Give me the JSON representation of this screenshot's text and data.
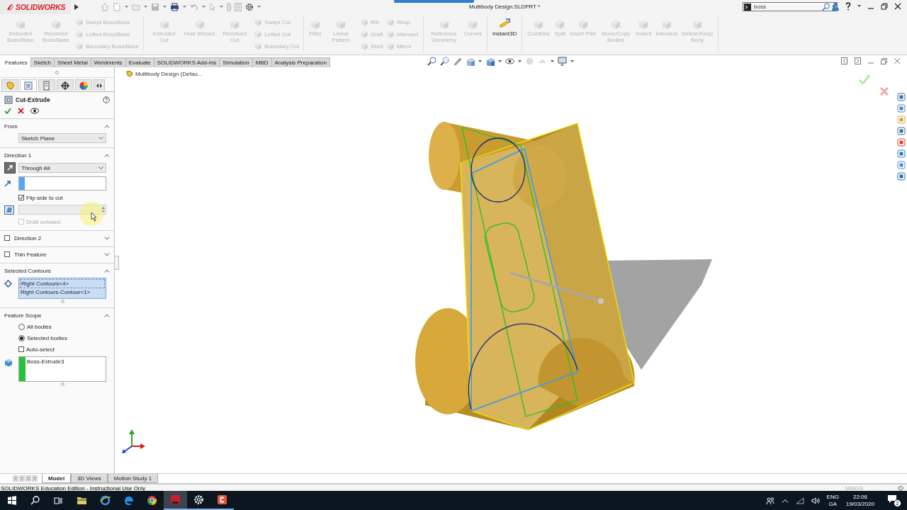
{
  "titlebar": {
    "logo": "SOLIDWORKS",
    "title": "Multibody Design.SLDPRT *",
    "search": {
      "value": "boss"
    }
  },
  "ribbon": {
    "groups": [
      {
        "items": [
          {
            "kind": "large",
            "label": "Extruded Boss/Base",
            "disabled": true
          },
          {
            "kind": "large",
            "label": "Revolved Boss/Base",
            "disabled": true
          },
          {
            "kind": "small",
            "label": "Swept Boss/Base",
            "disabled": true
          },
          {
            "kind": "small",
            "label": "Lofted Boss/Base",
            "disabled": true
          },
          {
            "kind": "small",
            "label": "Boundary Boss/Base",
            "disabled": true
          }
        ]
      },
      {
        "items": [
          {
            "kind": "large",
            "label": "Extruded Cut",
            "disabled": true
          },
          {
            "kind": "large",
            "label": "Hole Wizard",
            "disabled": true
          },
          {
            "kind": "large",
            "label": "Revolved Cut",
            "disabled": true
          },
          {
            "kind": "small",
            "label": "Swept Cut",
            "disabled": true
          },
          {
            "kind": "small",
            "label": "Lofted Cut",
            "disabled": true
          },
          {
            "kind": "small",
            "label": "Boundary Cut",
            "disabled": true
          }
        ]
      },
      {
        "items": [
          {
            "kind": "large",
            "label": "Fillet",
            "disabled": true
          },
          {
            "kind": "large",
            "label": "Linear Pattern",
            "disabled": true
          },
          {
            "kind": "small",
            "label": "Rib",
            "disabled": true
          },
          {
            "kind": "small",
            "label": "Draft",
            "disabled": true
          },
          {
            "kind": "small",
            "label": "Shell",
            "disabled": true
          },
          {
            "kind": "small",
            "label": "Wrap",
            "disabled": true
          },
          {
            "kind": "small",
            "label": "Intersect",
            "disabled": true
          },
          {
            "kind": "small",
            "label": "Mirror",
            "disabled": true
          }
        ]
      },
      {
        "items": [
          {
            "kind": "large",
            "label": "Reference Geometry",
            "disabled": true
          },
          {
            "kind": "large",
            "label": "Curves",
            "disabled": true
          }
        ]
      },
      {
        "items": [
          {
            "kind": "large",
            "label": "Instant3D",
            "disabled": false
          }
        ]
      },
      {
        "items": [
          {
            "kind": "large",
            "label": "Combine",
            "disabled": true
          },
          {
            "kind": "large",
            "label": "Split",
            "disabled": true
          },
          {
            "kind": "large",
            "label": "Insert Part",
            "disabled": true
          },
          {
            "kind": "large",
            "label": "Move/Copy Bodies",
            "disabled": true
          },
          {
            "kind": "large",
            "label": "Indent",
            "disabled": true
          },
          {
            "kind": "large",
            "label": "Intersect",
            "disabled": true
          },
          {
            "kind": "large",
            "label": "Delete/Keep Body",
            "disabled": true
          }
        ]
      }
    ]
  },
  "command_tabs": [
    {
      "label": "Features",
      "selected": true
    },
    {
      "label": "Sketch",
      "selected": false
    },
    {
      "label": "Sheet Metal",
      "selected": false
    },
    {
      "label": "Weldments",
      "selected": false
    },
    {
      "label": "Evaluate",
      "selected": false
    },
    {
      "label": "SOLIDWORKS Add-Ins",
      "selected": false
    },
    {
      "label": "Simulation",
      "selected": false
    },
    {
      "label": "MBD",
      "selected": false
    },
    {
      "label": "Analysis Preparation",
      "selected": false
    }
  ],
  "property_manager": {
    "panel_tabs": [
      {
        "selected": false
      },
      {
        "selected": true
      },
      {
        "selected": false
      },
      {
        "selected": false
      },
      {
        "selected": false
      }
    ],
    "title": "Cut-Extrude",
    "sections": [
      {
        "title": "From",
        "expanded": true,
        "controls": [
          {
            "kind": "dropdown",
            "value": "Sketch Plane"
          }
        ]
      },
      {
        "title": "Direction 1",
        "expanded": true,
        "controls": [
          {
            "kind": "end_condition",
            "value": "Through All"
          },
          {
            "kind": "depth"
          },
          {
            "kind": "checkbox",
            "label": "Flip side to cut",
            "checked": true,
            "disabled": false
          },
          {
            "kind": "spinner"
          },
          {
            "kind": "checkbox",
            "label": "Draft outward",
            "checked": false,
            "disabled": true
          }
        ]
      },
      {
        "title": "Direction 2",
        "expanded": false,
        "checked": false
      },
      {
        "title": "Thin Feature",
        "expanded": false,
        "checked": false
      },
      {
        "title": "Selected Contours",
        "expanded": true,
        "controls": [
          {
            "kind": "contour_list",
            "active": true,
            "items": [
              "Right Contours<4>",
              "Right Contours-Contour<1>"
            ]
          }
        ]
      },
      {
        "title": "Feature Scope",
        "expanded": true,
        "controls": [
          {
            "kind": "radio",
            "label": "All bodies",
            "selected": false
          },
          {
            "kind": "radio",
            "label": "Selected bodies",
            "selected": true
          },
          {
            "kind": "checkbox",
            "label": "Auto-select",
            "checked": false,
            "disabled": false
          },
          {
            "kind": "body_list",
            "active": false,
            "items": [
              "Boss-Extrude3"
            ]
          }
        ]
      }
    ]
  },
  "viewport": {
    "breadcrumb": "Multibody Design  (Defau..."
  },
  "bottom_tabs": [
    {
      "label": "Model",
      "selected": true
    },
    {
      "label": "3D Views",
      "selected": false
    },
    {
      "label": "Motion Study 1",
      "selected": false
    }
  ],
  "status_bar": {
    "text": "SOLIDWORKS Education Edition - Instructional Use Only",
    "units": "MMGS"
  },
  "taskbar": {
    "apps": [
      {
        "kind": "explorer",
        "active": false,
        "running": false
      },
      {
        "kind": "ie",
        "active": false,
        "running": false
      },
      {
        "kind": "edge",
        "active": false,
        "running": false
      },
      {
        "kind": "chrome",
        "active": false,
        "running": false
      },
      {
        "kind": "solidworks",
        "active": true,
        "running": true
      },
      {
        "kind": "settings",
        "active": false,
        "running": true
      },
      {
        "kind": "recorder",
        "active": false,
        "running": true
      }
    ],
    "language": "ENG",
    "layout": "GA",
    "time": "22:06",
    "date": "19/03/2020",
    "notifications": "2"
  }
}
